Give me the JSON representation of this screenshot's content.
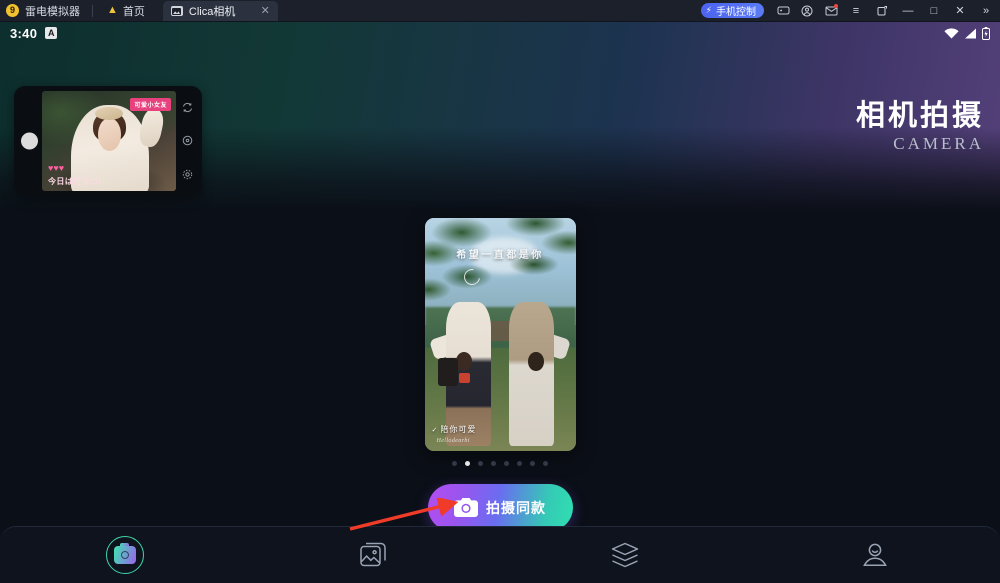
{
  "titlebar": {
    "app_name": "雷电模拟器",
    "logo_glyph": "9",
    "home_label": "首页",
    "home_icon": "home-icon",
    "tabs": [
      {
        "label": "Clica相机",
        "icon": "app-thumbnail-icon",
        "close_glyph": "✕",
        "active": true
      }
    ],
    "phone_control": {
      "label": "手机控制",
      "icon": "lightning-bolt-icon",
      "color": "#4c63f0"
    },
    "icons": [
      {
        "name": "gamepad-icon"
      },
      {
        "name": "account-icon"
      },
      {
        "name": "mail-icon",
        "badge": true
      }
    ],
    "window_controls": {
      "menu": "≡",
      "restore_window": "⇲",
      "minimize": "—",
      "maximize": "□",
      "close": "✕",
      "expand": "»"
    }
  },
  "statusbar": {
    "time": "3:40",
    "app_badge": "A",
    "icons": [
      "wifi-icon",
      "signal-icon",
      "battery-icon"
    ]
  },
  "hero": {
    "title": "相机拍摄",
    "subtitle": "CAMERA",
    "gradient_from": "#0d2f2e",
    "gradient_to": "#54407a"
  },
  "preview": {
    "badge_text": "可爱小女友",
    "caption": "今日は可らつ!",
    "hearts": "♥♥♥",
    "side_icons": [
      "flip-camera-icon",
      "timer-icon",
      "settings-icon"
    ]
  },
  "card": {
    "top_text": "希望一直都是你",
    "bottom_text": "陪你可爱",
    "bottom_tick": "✓",
    "signature": "Hellodearhi"
  },
  "carousel": {
    "total_dots": 8,
    "active_index": 1
  },
  "cta": {
    "label": "拍摄同款",
    "icon": "camera-icon",
    "gradient_from": "#b34df0",
    "gradient_to": "#2fe0b0"
  },
  "annotation": {
    "arrow_color": "#f03b28",
    "name": "red-pointer-arrow"
  },
  "bottom_nav": {
    "items": [
      {
        "name": "nav-camera",
        "icon": "camera-icon",
        "active": true
      },
      {
        "name": "nav-gallery",
        "icon": "gallery-icon",
        "active": false
      },
      {
        "name": "nav-templates",
        "icon": "layers-icon",
        "active": false
      },
      {
        "name": "nav-profile",
        "icon": "person-icon",
        "active": false
      }
    ]
  }
}
